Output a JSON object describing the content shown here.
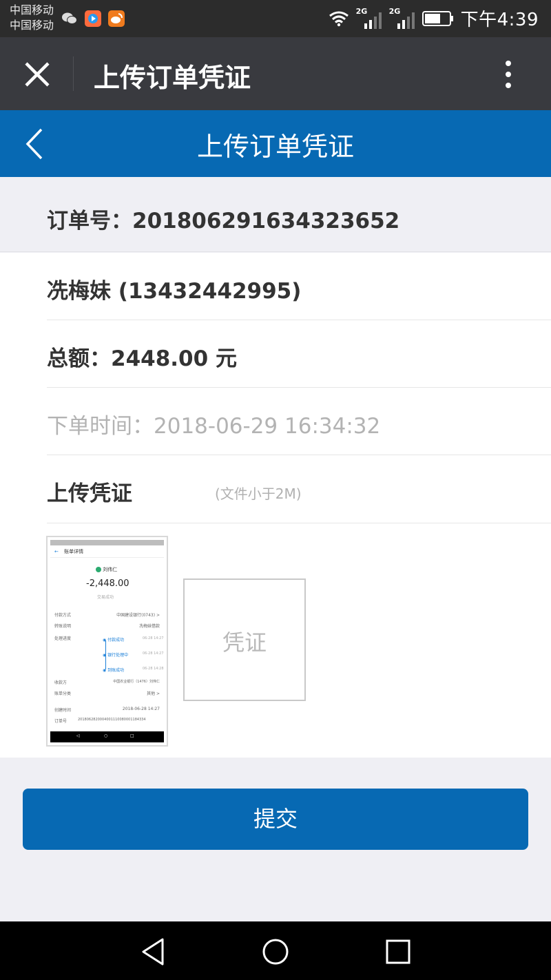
{
  "status_bar": {
    "carrier_1": "中国移动",
    "carrier_2": "中国移动",
    "network_1": "2G",
    "network_2": "2G",
    "time": "下午4:39",
    "icons": [
      "wechat-icon",
      "video-app-icon",
      "weibo-icon",
      "wifi-icon",
      "signal-icon",
      "battery-icon"
    ]
  },
  "wechat_bar": {
    "title": "上传订单凭证"
  },
  "page_header": {
    "title": "上传订单凭证"
  },
  "order": {
    "number_text": "订单号：201806291634323652",
    "customer_text": "冼梅妹 (13432442995)",
    "total_text": "总额：2448.00 元",
    "time_text": "下单时间：2018-06-29 16:34:32"
  },
  "upload": {
    "label": "上传凭证",
    "hint": "(文件小于2M)",
    "placeholder_label": "凭证",
    "thumbnail": {
      "header": "账单详情",
      "payee": "刘伟仁",
      "amount": "-2,448.00",
      "status": "交易成功",
      "rows": [
        {
          "k": "付款方式",
          "v": "中国建设银行(0743) >"
        },
        {
          "k": "转账说明",
          "v": "冼梅妹借款"
        },
        {
          "k": "处理进度",
          "v": ""
        },
        {
          "k": "收款方",
          "v": "中国农业银行（1476）刘伟仁"
        },
        {
          "k": "账单分类",
          "v": "其他 >"
        },
        {
          "k": "创建时间",
          "v": "2018-06-28 14:27"
        },
        {
          "k": "订单号",
          "v": "2018062820004001110080001184334"
        }
      ],
      "progress": [
        {
          "label": "付款成功",
          "time": "06-28 14:27"
        },
        {
          "label": "银行处理中",
          "time": "06-28 14:27"
        },
        {
          "label": "到账成功",
          "time": "06-28 14:28"
        }
      ]
    }
  },
  "submit_label": "提交",
  "colors": {
    "brand_blue": "#0769b3",
    "wechat_bar": "#393a3f",
    "background": "#efeff4"
  }
}
